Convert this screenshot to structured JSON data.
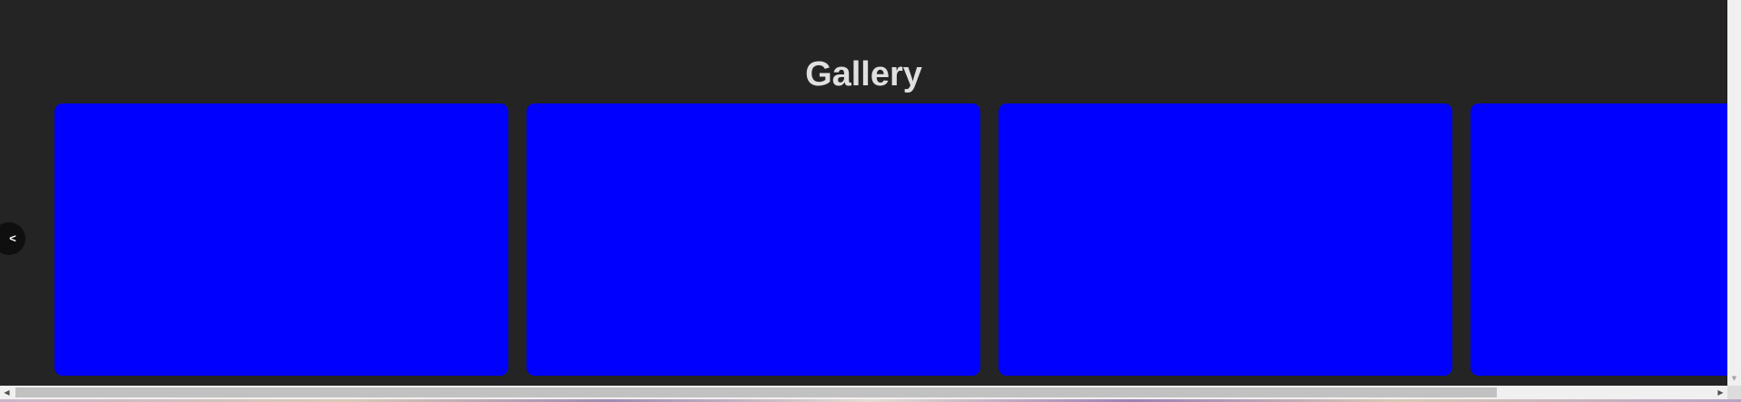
{
  "gallery": {
    "title": "Gallery",
    "prev_button_label": "<",
    "card_color": "#0000ff",
    "background_color": "#242424",
    "cards": [
      {
        "label": ""
      },
      {
        "label": ""
      },
      {
        "label": ""
      },
      {
        "label": ""
      }
    ]
  },
  "scrollbars": {
    "vertical_down_arrow": "▼",
    "horizontal_left_arrow": "◀",
    "horizontal_right_arrow": "▶"
  }
}
